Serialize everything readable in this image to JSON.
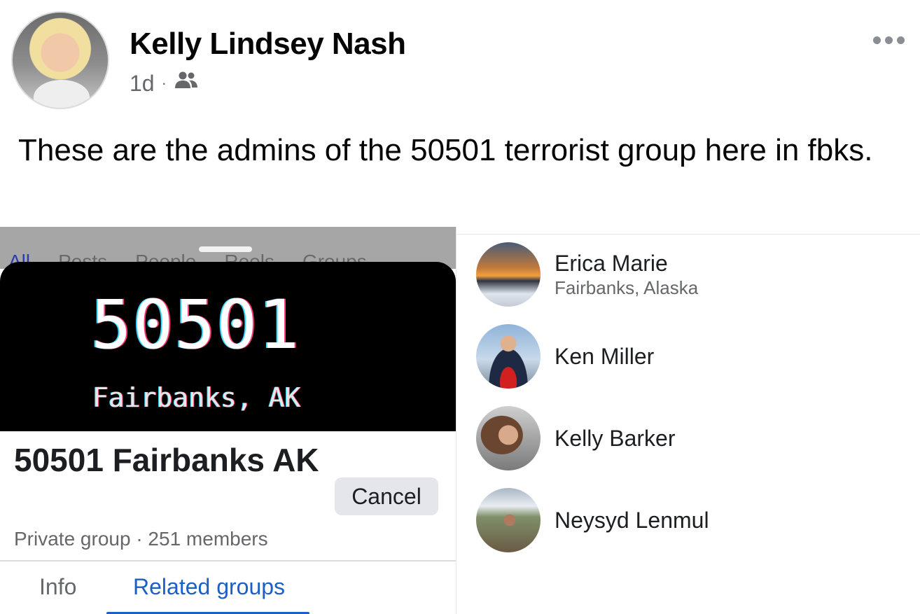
{
  "post": {
    "author": "Kelly Lindsey Nash",
    "time": "1d",
    "separator": "·",
    "audience_icon": "friends-icon",
    "more_icon": "more-dots-icon",
    "text": "These are the admins of the 50501 terrorist group here in fbks."
  },
  "screenshot_left": {
    "ghost_tabs": [
      "All",
      "Posts",
      "People",
      "Reels",
      "Groups"
    ],
    "banner_number": "50501",
    "banner_sub": "Fairbanks, AK",
    "group_name": "50501 Fairbanks AK",
    "cancel_label": "Cancel",
    "group_meta": "Private group · 251 members",
    "tabs": {
      "info": "Info",
      "related": "Related groups"
    }
  },
  "people": [
    {
      "name": "Erica Marie",
      "subtitle": "Fairbanks, Alaska"
    },
    {
      "name": "Ken Miller",
      "subtitle": ""
    },
    {
      "name": "Kelly Barker",
      "subtitle": ""
    },
    {
      "name": "Neysyd Lenmul",
      "subtitle": ""
    }
  ],
  "colors": {
    "link_blue": "#1b5fc7",
    "meta_grey": "#65676b"
  }
}
